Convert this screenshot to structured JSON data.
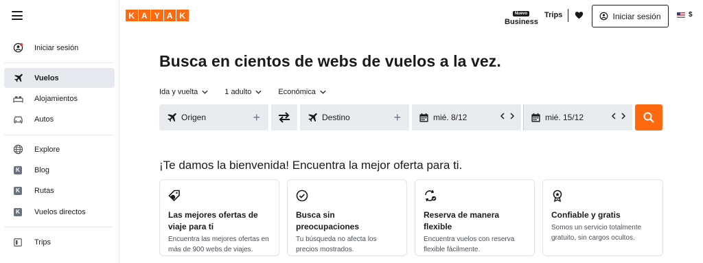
{
  "sidebar": {
    "items": [
      {
        "label": "Iniciar sesión",
        "icon": "user-icon"
      },
      {
        "label": "Vuelos",
        "icon": "plane-icon",
        "active": true
      },
      {
        "label": "Alojamientos",
        "icon": "bed-icon"
      },
      {
        "label": "Autos",
        "icon": "car-icon"
      },
      {
        "label": "Explore",
        "icon": "globe-icon"
      },
      {
        "label": "Blog",
        "icon": "kayak-k-icon"
      },
      {
        "label": "Rutas",
        "icon": "kayak-k-icon"
      },
      {
        "label": "Vuelos directos",
        "icon": "kayak-k-icon"
      },
      {
        "label": "Trips",
        "icon": "trips-icon"
      }
    ]
  },
  "header": {
    "logo_letters": [
      "K",
      "A",
      "Y",
      "A",
      "K"
    ],
    "business_badge": "Nuevo",
    "business_label": "Business",
    "trips_label": "Trips",
    "signin_label": "Iniciar sesión",
    "currency": "$"
  },
  "main": {
    "headline": "Busca en cientos de webs de vuelos a la vez.",
    "options": {
      "trip_type": "Ida y vuelta",
      "passengers": "1 adulto",
      "cabin": "Económica"
    },
    "search": {
      "origin_placeholder": "Origen",
      "destination_placeholder": "Destino",
      "depart_date": "mié. 8/12",
      "return_date": "mié. 15/12"
    },
    "welcome": "¡Te damos la bienvenida! Encuentra la mejor oferta para ti.",
    "cards": [
      {
        "title": "Las mejores ofertas de viaje para ti",
        "desc": "Encuentra las mejores ofertas en más de 900 webs de viajes."
      },
      {
        "title": "Busca sin preocupaciones",
        "desc": "Tu búsqueda no afecta los precios mostrados."
      },
      {
        "title": "Reserva de manera flexible",
        "desc": "Encuentra vuelos con reserva flexible fácilmente."
      },
      {
        "title": "Confiable y gratis",
        "desc": "Somos un servicio totalmente gratuito, sin cargos ocultos."
      }
    ]
  },
  "colors": {
    "brand": "#ff690f",
    "field_bg": "#e9ecef",
    "active_nav_bg": "#e6e9ed"
  }
}
